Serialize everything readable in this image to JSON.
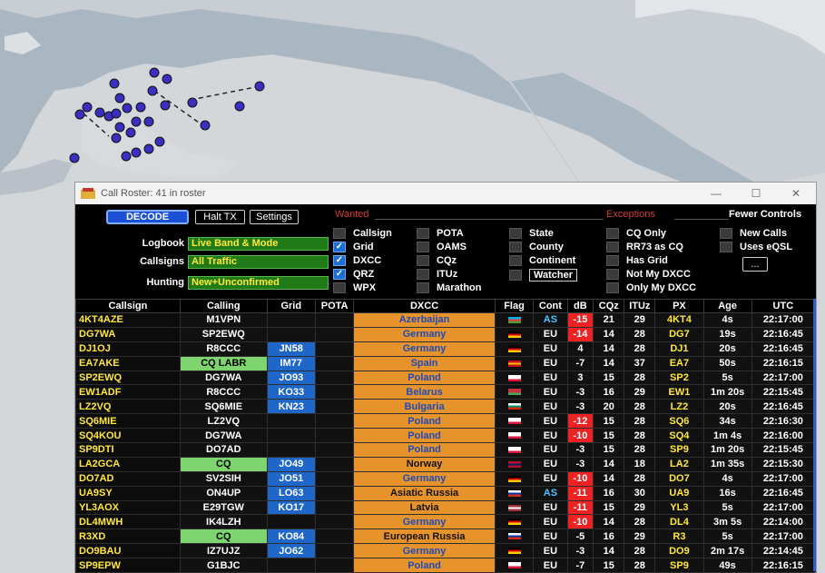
{
  "window": {
    "title": "Call Roster: 41 in roster",
    "minimize": "—",
    "maximize": "☐",
    "close": "✕"
  },
  "controls": {
    "decode": "DECODE",
    "halt_tx": "Halt TX",
    "settings": "Settings",
    "logbook_label": "Logbook",
    "logbook_value": "Live Band & Mode",
    "callsigns_label": "Callsigns",
    "callsigns_value": "All Traffic",
    "hunting_label": "Hunting",
    "hunting_value": "New+Unconfirmed",
    "wanted_label": "Wanted",
    "exceptions_label": "Exceptions",
    "fewer_controls": "Fewer Controls",
    "wanted_items": [
      {
        "label": "Callsign",
        "checked": false
      },
      {
        "label": "Grid",
        "checked": true
      },
      {
        "label": "DXCC",
        "checked": true
      },
      {
        "label": "QRZ",
        "checked": true
      },
      {
        "label": "WPX",
        "checked": false
      },
      {
        "label": "POTA",
        "checked": false
      },
      {
        "label": "OAMS",
        "checked": false
      },
      {
        "label": "CQz",
        "checked": false
      },
      {
        "label": "ITUz",
        "checked": false
      },
      {
        "label": "Marathon",
        "checked": false
      },
      {
        "label": "State",
        "checked": false
      },
      {
        "label": "County",
        "checked": false
      },
      {
        "label": "Continent",
        "checked": false
      },
      {
        "label": "Watcher",
        "checked": false
      }
    ],
    "exception_items": [
      {
        "label": "CQ Only",
        "checked": false
      },
      {
        "label": "RR73 as CQ",
        "checked": false
      },
      {
        "label": "Has Grid",
        "checked": false
      },
      {
        "label": "Not My DXCC",
        "checked": false
      },
      {
        "label": "Only My DXCC",
        "checked": false
      },
      {
        "label": "New Calls",
        "checked": false
      },
      {
        "label": "Uses eQSL",
        "checked": false
      }
    ],
    "more": "..."
  },
  "columns": [
    "Callsign",
    "Calling",
    "Grid",
    "POTA",
    "DXCC",
    "Flag",
    "Cont",
    "dB",
    "CQz",
    "ITUz",
    "PX",
    "Age",
    "UTC"
  ],
  "rows": [
    {
      "call": "4KT4AZE",
      "calling": "M1VPN",
      "grid": "",
      "pota": "",
      "dxcc": "Azerbaijan",
      "flag": "az",
      "cont": "AS",
      "db": "-15",
      "cqz": "21",
      "ituz": "29",
      "px": "4KT4",
      "age": "4s",
      "utc": "22:17:00"
    },
    {
      "call": "DG7WA",
      "calling": "SP2EWQ",
      "grid": "",
      "pota": "",
      "dxcc": "Germany",
      "flag": "de",
      "cont": "EU",
      "db": "-14",
      "cqz": "14",
      "ituz": "28",
      "px": "DG7",
      "age": "19s",
      "utc": "22:16:45"
    },
    {
      "call": "DJ1OJ",
      "calling": "R8CCC",
      "grid": "JN58",
      "pota": "",
      "dxcc": "Germany",
      "flag": "de",
      "cont": "EU",
      "db": "4",
      "cqz": "14",
      "ituz": "28",
      "px": "DJ1",
      "age": "20s",
      "utc": "22:16:45"
    },
    {
      "call": "EA7AKE",
      "calling": "CQ LABR",
      "grid": "IM77",
      "pota": "",
      "dxcc": "Spain",
      "flag": "es",
      "cont": "EU",
      "db": "-7",
      "cqz": "14",
      "ituz": "37",
      "px": "EA7",
      "age": "50s",
      "utc": "22:16:15"
    },
    {
      "call": "SP2EWQ",
      "calling": "DG7WA",
      "grid": "JO93",
      "pota": "",
      "dxcc": "Poland",
      "flag": "pl",
      "cont": "EU",
      "db": "3",
      "cqz": "15",
      "ituz": "28",
      "px": "SP2",
      "age": "5s",
      "utc": "22:17:00"
    },
    {
      "call": "EW1ADF",
      "calling": "R8CCC",
      "grid": "KO33",
      "pota": "",
      "dxcc": "Belarus",
      "flag": "by",
      "cont": "EU",
      "db": "-3",
      "cqz": "16",
      "ituz": "29",
      "px": "EW1",
      "age": "1m 20s",
      "utc": "22:15:45"
    },
    {
      "call": "LZ2VQ",
      "calling": "SQ6MIE",
      "grid": "KN23",
      "pota": "",
      "dxcc": "Bulgaria",
      "flag": "bg",
      "cont": "EU",
      "db": "-3",
      "cqz": "20",
      "ituz": "28",
      "px": "LZ2",
      "age": "20s",
      "utc": "22:16:45"
    },
    {
      "call": "SQ6MIE",
      "calling": "LZ2VQ",
      "grid": "",
      "pota": "",
      "dxcc": "Poland",
      "flag": "pl",
      "cont": "EU",
      "db": "-12",
      "cqz": "15",
      "ituz": "28",
      "px": "SQ6",
      "age": "34s",
      "utc": "22:16:30"
    },
    {
      "call": "SQ4KOU",
      "calling": "DG7WA",
      "grid": "",
      "pota": "",
      "dxcc": "Poland",
      "flag": "pl",
      "cont": "EU",
      "db": "-10",
      "cqz": "15",
      "ituz": "28",
      "px": "SQ4",
      "age": "1m 4s",
      "utc": "22:16:00"
    },
    {
      "call": "SP9DTI",
      "calling": "DO7AD",
      "grid": "",
      "pota": "",
      "dxcc": "Poland",
      "flag": "pl",
      "cont": "EU",
      "db": "-3",
      "cqz": "15",
      "ituz": "28",
      "px": "SP9",
      "age": "1m 20s",
      "utc": "22:15:45"
    },
    {
      "call": "LA2GCA",
      "calling": "CQ",
      "grid": "JO49",
      "pota": "",
      "dxcc": "Norway",
      "flag": "no",
      "cont": "EU",
      "db": "-3",
      "cqz": "14",
      "ituz": "18",
      "px": "LA2",
      "age": "1m 35s",
      "utc": "22:15:30"
    },
    {
      "call": "DO7AD",
      "calling": "SV2SIH",
      "grid": "JO51",
      "pota": "",
      "dxcc": "Germany",
      "flag": "de",
      "cont": "EU",
      "db": "-10",
      "cqz": "14",
      "ituz": "28",
      "px": "DO7",
      "age": "4s",
      "utc": "22:17:00"
    },
    {
      "call": "UA9SY",
      "calling": "ON4UP",
      "grid": "LO63",
      "pota": "",
      "dxcc": "Asiatic Russia",
      "flag": "ru",
      "cont": "AS",
      "db": "-11",
      "cqz": "16",
      "ituz": "30",
      "px": "UA9",
      "age": "16s",
      "utc": "22:16:45"
    },
    {
      "call": "YL3AOX",
      "calling": "E29TGW",
      "grid": "KO17",
      "pota": "",
      "dxcc": "Latvia",
      "flag": "lv",
      "cont": "EU",
      "db": "-11",
      "cqz": "15",
      "ituz": "29",
      "px": "YL3",
      "age": "5s",
      "utc": "22:17:00"
    },
    {
      "call": "DL4MWH",
      "calling": "IK4LZH",
      "grid": "",
      "pota": "",
      "dxcc": "Germany",
      "flag": "de",
      "cont": "EU",
      "db": "-10",
      "cqz": "14",
      "ituz": "28",
      "px": "DL4",
      "age": "3m 5s",
      "utc": "22:14:00"
    },
    {
      "call": "R3XD",
      "calling": "CQ",
      "grid": "KO84",
      "pota": "",
      "dxcc": "European Russia",
      "flag": "ru",
      "cont": "EU",
      "db": "-5",
      "cqz": "16",
      "ituz": "29",
      "px": "R3",
      "age": "5s",
      "utc": "22:17:00"
    },
    {
      "call": "DO9BAU",
      "calling": "IZ7UJZ",
      "grid": "JO62",
      "pota": "",
      "dxcc": "Germany",
      "flag": "de",
      "cont": "EU",
      "db": "-3",
      "cqz": "14",
      "ituz": "28",
      "px": "DO9",
      "age": "2m 17s",
      "utc": "22:14:45"
    },
    {
      "call": "SP9EPW",
      "calling": "G1BJC",
      "grid": "",
      "pota": "",
      "dxcc": "Poland",
      "flag": "pl",
      "cont": "EU",
      "db": "-7",
      "cqz": "15",
      "ituz": "28",
      "px": "SP9",
      "age": "49s",
      "utc": "22:16:15"
    }
  ],
  "colors": {
    "accent": "#1a4fd6",
    "dxcc_bg": "#e7932c",
    "grid_bg": "#1e66c8",
    "cq_bg": "#7ed56f",
    "call_text": "#ffe83a",
    "db_red": "#e22222"
  }
}
